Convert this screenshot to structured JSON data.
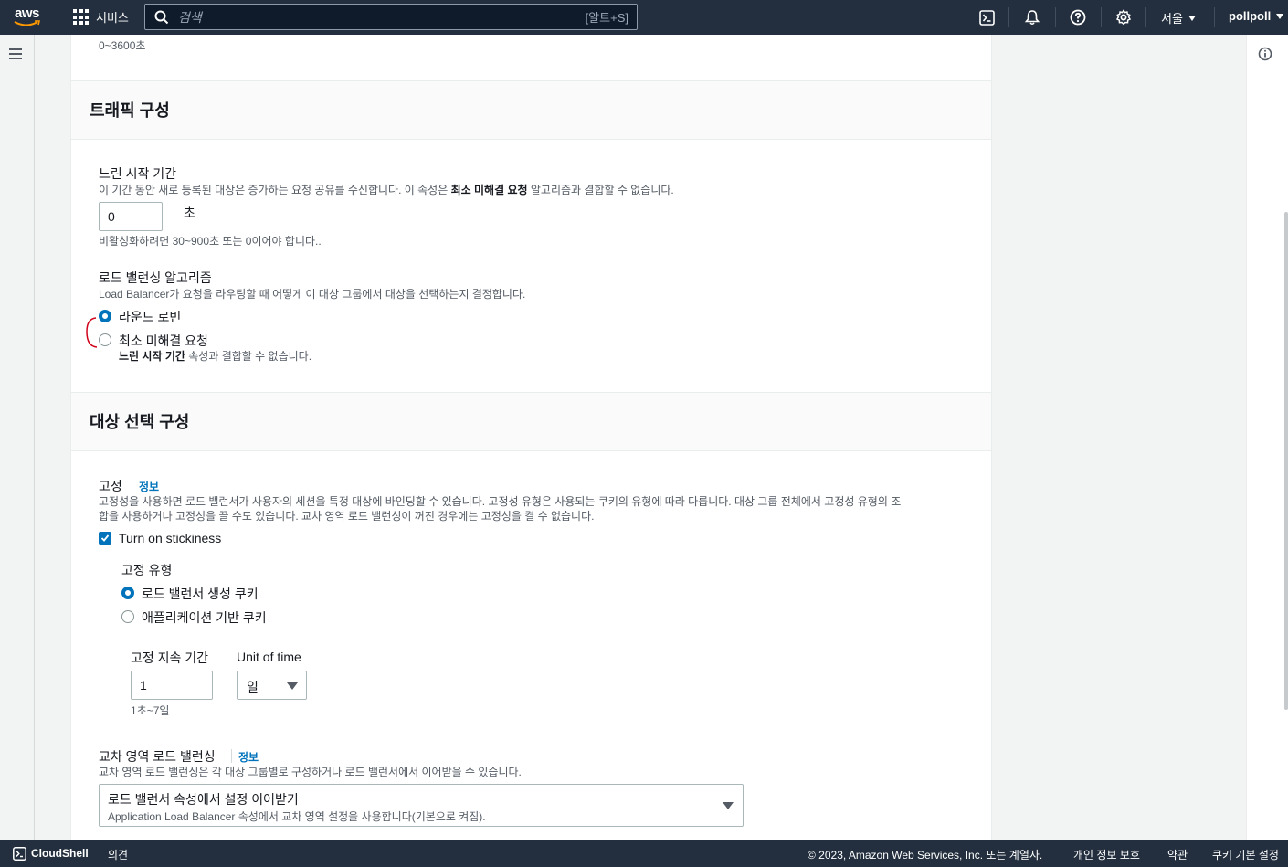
{
  "topnav": {
    "logo_text": "aws",
    "services_label": "서비스",
    "search_placeholder": "검색",
    "search_shortcut": "[알트+S]",
    "region": "서울",
    "user": "pollpoll"
  },
  "form": {
    "timeout_hint": "0~3600초",
    "traffic_section": {
      "title": "트래픽 구성",
      "slow_start": {
        "label": "느린 시작 기간",
        "desc_pre": "이 기간 동안 새로 등록된 대상은 증가하는 요청 공유를 수신합니다. 이 속성은 ",
        "desc_bold": "최소 미해결 요청",
        "desc_post": " 알고리즘과 결합할 수 없습니다.",
        "value": "0",
        "unit": "초",
        "hint": "비활성화하려면 30~900초 또는 0이어야 합니다.."
      },
      "algorithm": {
        "label": "로드 밸런싱 알고리즘",
        "desc": "Load Balancer가 요청을 라우팅할 때 어떻게 이 대상 그룹에서 대상을 선택하는지 결정합니다.",
        "options": [
          {
            "label": "라운드 로빈",
            "checked": true
          },
          {
            "label": "최소 미해결 요청",
            "checked": false
          }
        ],
        "option2_desc_bold": "느린 시작 기간",
        "option2_desc_post": " 속성과 결합할 수 없습니다."
      }
    },
    "target_section": {
      "title": "대상 선택 구성",
      "stickiness": {
        "label": "고정",
        "info": "정보",
        "desc_line1": "고정성을 사용하면 로드 밸런서가 사용자의 세션을 특정 대상에 바인딩할 수 있습니다. 고정성 유형은 사용되는 쿠키의 유형에 따라 다릅니다. 대상 그룹 전체에서 고정성 유형의 조",
        "desc_line2": "합을 사용하거나 고정성을 끌 수도 있습니다. 교차 영역 로드 밸런싱이 꺼진 경우에는 고정성을 켤 수 없습니다.",
        "checkbox_label": "Turn on stickiness",
        "type_label": "고정 유형",
        "type_options": [
          {
            "label": "로드 밸런서 생성 쿠키",
            "checked": true
          },
          {
            "label": "애플리케이션 기반 쿠키",
            "checked": false
          }
        ],
        "duration_label": "고정 지속 기간",
        "duration_value": "1",
        "duration_hint": "1초~7일",
        "unit_label": "Unit of time",
        "unit_value": "일"
      },
      "cross_zone": {
        "label": "교차 영역 로드 밸런싱",
        "info": "정보",
        "desc": "교차 영역 로드 밸런싱은 각 대상 그룹별로 구성하거나 로드 밸런서에서 이어받을 수 있습니다.",
        "select_value": "로드 밸런서 속성에서 설정 이어받기",
        "select_desc": "Application Load Balancer 속성에서 교차 영역 설정을 사용합니다(기본으로 켜짐)."
      }
    }
  },
  "footer": {
    "cloudshell": "CloudShell",
    "feedback": "의견",
    "copyright": "© 2023, Amazon Web Services, Inc. 또는 계열사.",
    "privacy": "개인 정보 보호",
    "terms": "약관",
    "cookies": "쿠키 기본 설정"
  },
  "colors": {
    "nav_bg": "#232f3e",
    "accent": "#0073bb",
    "annotation": "#d0021b"
  }
}
